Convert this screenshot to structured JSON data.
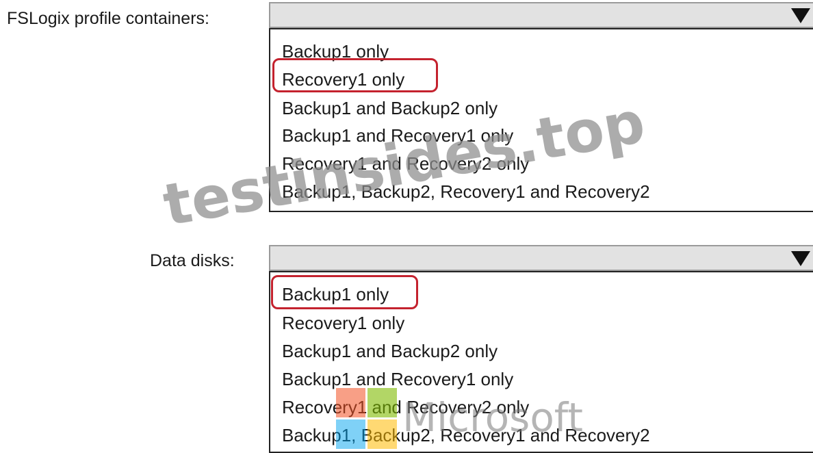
{
  "questions": [
    {
      "label": "FSLogix profile containers:",
      "options": [
        "Backup1 only",
        "Recovery1 only",
        "Backup1 and Backup2 only",
        "Backup1 and Recovery1 only",
        "Recovery1 and Recovery2 only",
        "Backup1, Backup2, Recovery1 and Recovery2"
      ],
      "selected_option": "Recovery1 only"
    },
    {
      "label": "Data disks:",
      "options": [
        "Backup1 only",
        "Recovery1 only",
        "Backup1 and Backup2 only",
        "Backup1 and Recovery1 only",
        "Recovery1 and Recovery2 only",
        "Backup1, Backup2, Recovery1 and Recovery2"
      ],
      "selected_option": "Backup1 only"
    }
  ],
  "watermark": {
    "text": "testinsides.top",
    "logo_wordmark": "Microsoft",
    "logo_colors": [
      "#f25022",
      "#7fba00",
      "#00a4ef",
      "#ffb900"
    ]
  },
  "colors": {
    "selection_outline": "#c4222e",
    "dropdown_fill": "#e2e2e2"
  },
  "icons": {
    "dropdown_arrow": "triangle-down-icon"
  }
}
